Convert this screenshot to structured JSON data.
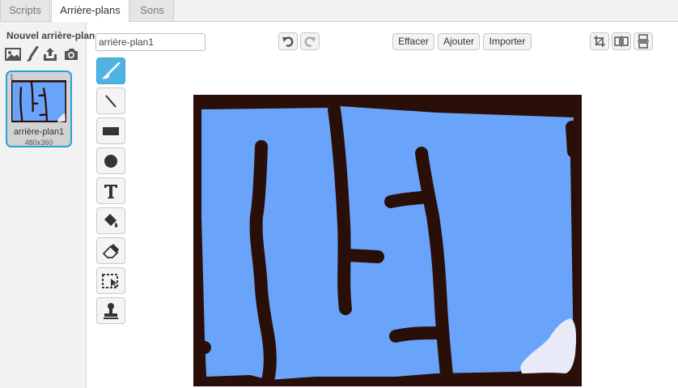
{
  "tabs": [
    {
      "label": "Scripts"
    },
    {
      "label": "Arrière-plans"
    },
    {
      "label": "Sons"
    }
  ],
  "left_panel": {
    "new_backdrop_label": "Nouvel arrière-plan:",
    "new_buttons": [
      "image-library-icon",
      "paintbrush-icon",
      "upload-icon",
      "camera-icon"
    ],
    "backdrops": [
      {
        "number": "1",
        "name": "arrière-plan1",
        "size": "480x360"
      }
    ]
  },
  "editor": {
    "costume_name_value": "arrière-plan1",
    "undo_icon": "undo-icon",
    "redo_icon": "redo-icon",
    "clear_label": "Effacer",
    "add_label": "Ajouter",
    "import_label": "Importer",
    "right_icons": [
      "crop-icon",
      "flip-horizontal-icon",
      "flip-vertical-icon"
    ]
  },
  "tools": [
    "brush",
    "line",
    "rectangle",
    "ellipse",
    "text",
    "fill",
    "eraser",
    "select",
    "stamp"
  ],
  "selected_tool": "brush",
  "colors": {
    "accent": "#27a3d6",
    "selected_tool_bg": "#4fb3e3",
    "canvas_fill": "#6aa4fa",
    "canvas_lines": "#2a0f08",
    "canvas_patch": "#e8eaf8",
    "thumb_card_bg": "#d2d2d2"
  }
}
